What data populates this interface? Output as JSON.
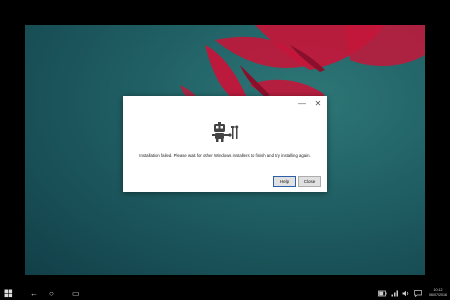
{
  "dialog": {
    "minimize_glyph": "—",
    "close_glyph": "✕",
    "message": "Installation failed. Please wait for other Windows installers to finish and try installing again.",
    "help_label": "Help",
    "close_label": "Close"
  },
  "taskbar": {
    "start_icon": "windows-logo-icon",
    "back_glyph": "←",
    "home_glyph": "○",
    "task_glyph": "▭",
    "time": "10:12",
    "date": "06/07/2016"
  },
  "colors": {
    "wallpaper": "#1f5e63",
    "flower": "#c4163a",
    "dialog_bg": "#ffffff",
    "button_bg": "#e1e1e1",
    "focus_border": "#2b5fa9"
  }
}
